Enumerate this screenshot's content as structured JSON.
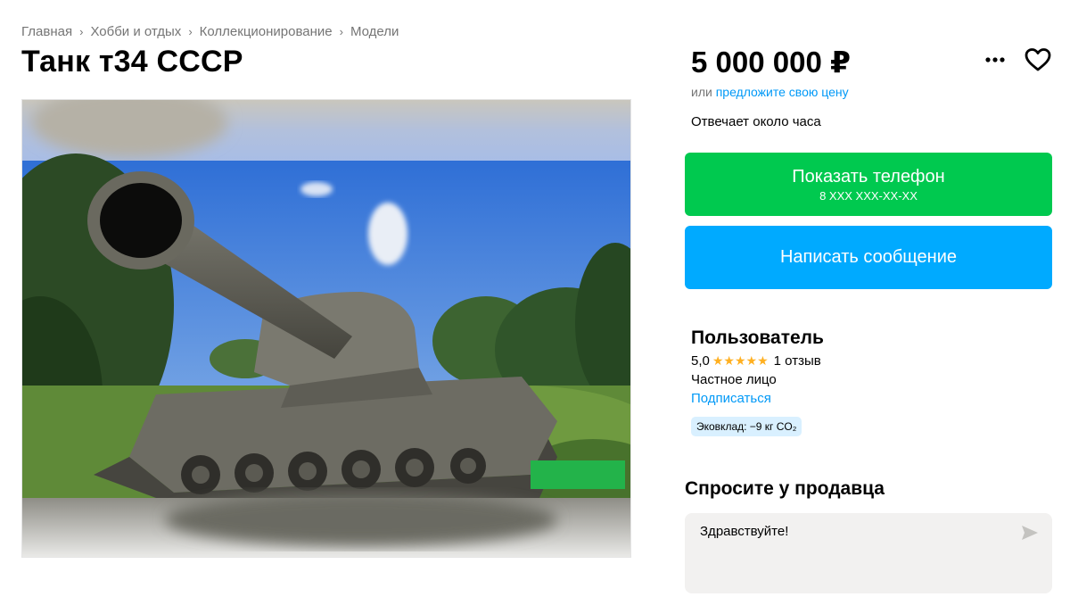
{
  "breadcrumb": [
    "Главная",
    "Хобби и отдых",
    "Коллекционирование",
    "Модели"
  ],
  "breadcrumb_separator": "›",
  "listing": {
    "title": "Танк т34 СССР",
    "price": "5 000 000 ₽",
    "offer_prefix": "или",
    "offer_link": "предложите свою цену",
    "responds": "Отвечает около часа"
  },
  "buttons": {
    "phone_label": "Показать телефон",
    "phone_masked": "8 XXX XXX-XX-XX",
    "message_label": "Написать сообщение"
  },
  "seller": {
    "name": "Пользователь",
    "rating": "5,0",
    "stars": 5,
    "reviews": "1 отзыв",
    "type": "Частное лицо",
    "subscribe": "Подписаться",
    "eco": "Эковклад: −9 кг CO₂"
  },
  "ask": {
    "title": "Спросите у продавца",
    "input_value": "Здравствуйте!"
  },
  "icons": {
    "more": "more-dots-icon",
    "favorite": "heart-icon",
    "send": "send-arrow-icon",
    "breadcrumb_sep": "chevron-right-icon"
  },
  "colors": {
    "phone_button": "#00c94f",
    "message_button": "#00aaff",
    "link": "#0099f7",
    "star": "#ffb021",
    "eco_badge": "#d9f0ff"
  }
}
